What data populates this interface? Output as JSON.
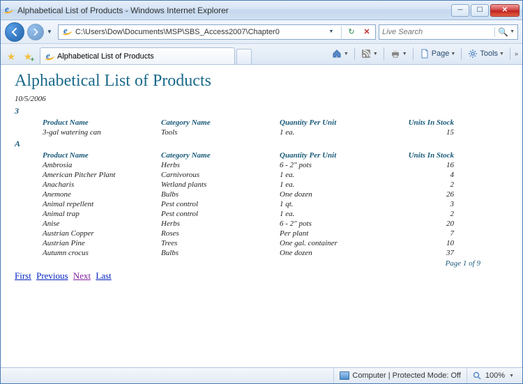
{
  "window": {
    "title": "Alphabetical List of Products - Windows Internet Explorer"
  },
  "nav": {
    "address": "C:\\Users\\Dow\\Documents\\MSP\\SBS_Access2007\\Chapter0",
    "search_placeholder": "Live Search"
  },
  "tab": {
    "label": "Alphabetical List of Products"
  },
  "toolbar": {
    "page_label": "Page",
    "tools_label": "Tools"
  },
  "report": {
    "title": "Alphabetical List of Products",
    "date": "10/5/2006",
    "columns": {
      "product": "Product Name",
      "category": "Category Name",
      "qty": "Quantity Per Unit",
      "stock": "Units In Stock"
    },
    "groups": [
      {
        "letter": "3",
        "rows": [
          {
            "product": "3-gal watering can",
            "category": "Tools",
            "qty": "1 ea.",
            "stock": "15"
          }
        ]
      },
      {
        "letter": "A",
        "rows": [
          {
            "product": "Ambrosia",
            "category": "Herbs",
            "qty": "6 - 2\" pots",
            "stock": "16"
          },
          {
            "product": "American Pitcher Plant",
            "category": "Carnivorous",
            "qty": "1 ea.",
            "stock": "4"
          },
          {
            "product": "Anacharis",
            "category": "Wetland plants",
            "qty": "1 ea.",
            "stock": "2"
          },
          {
            "product": "Anemone",
            "category": "Bulbs",
            "qty": "One dozen",
            "stock": "26"
          },
          {
            "product": "Animal repellent",
            "category": "Pest control",
            "qty": "1 qt.",
            "stock": "3"
          },
          {
            "product": "Animal trap",
            "category": "Pest control",
            "qty": "1 ea.",
            "stock": "2"
          },
          {
            "product": "Anise",
            "category": "Herbs",
            "qty": "6 - 2\" pots",
            "stock": "20"
          },
          {
            "product": "Austrian Copper",
            "category": "Roses",
            "qty": "Per plant",
            "stock": "7"
          },
          {
            "product": "Austrian Pine",
            "category": "Trees",
            "qty": "One gal. container",
            "stock": "10"
          },
          {
            "product": "Autumn crocus",
            "category": "Bulbs",
            "qty": "One dozen",
            "stock": "37"
          }
        ]
      }
    ],
    "page_info": "Page 1 of 9",
    "nav_links": {
      "first": "First",
      "prev": "Previous",
      "next": "Next",
      "last": "Last"
    }
  },
  "status": {
    "zone": "Computer | Protected Mode: Off",
    "zoom": "100%"
  }
}
